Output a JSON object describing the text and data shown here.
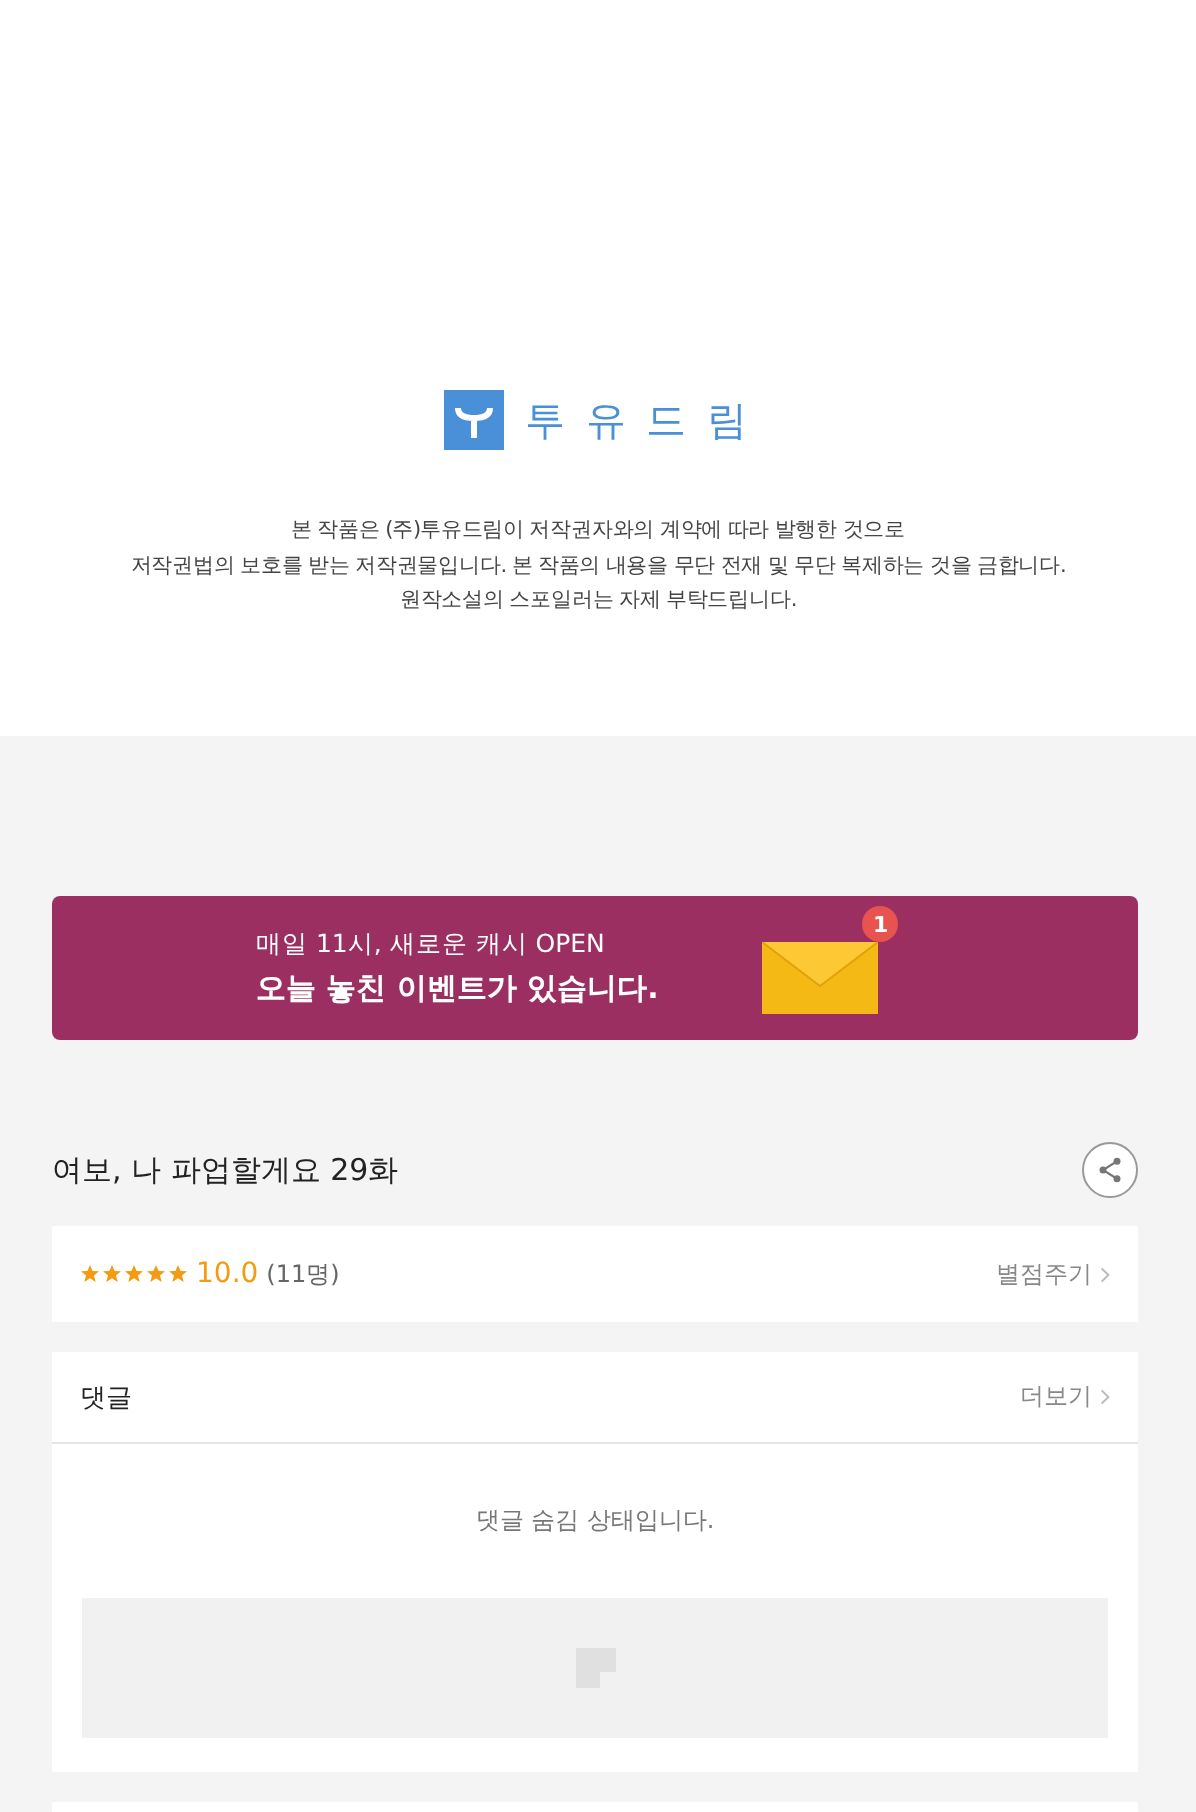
{
  "publisher": {
    "name": "투 유 드 림"
  },
  "notice": [
    "본 작품은 (주)투유드림이 저작권자와의 계약에 따라 발행한 것으로",
    "저작권법의 보호를 받는 저작권물입니다. 본 작품의 내용을 무단 전재 및 무단 복제하는 것을 금합니다.",
    "원작소설의 스포일러는 자제 부탁드립니다."
  ],
  "banner": {
    "line_1": "매일 11시, 새로운 캐시 OPEN",
    "line_2": "오늘 놓친 이벤트가 있습니다.",
    "badge": "1"
  },
  "episode": {
    "title": "여보, 나 파업할게요 29화"
  },
  "rating": {
    "stars": 5,
    "score": "10.0",
    "count": "(11명)",
    "action": "별점주기"
  },
  "comments": {
    "title": "댓글",
    "more": "더보기",
    "message": "댓글 숨김 상태입니다."
  }
}
